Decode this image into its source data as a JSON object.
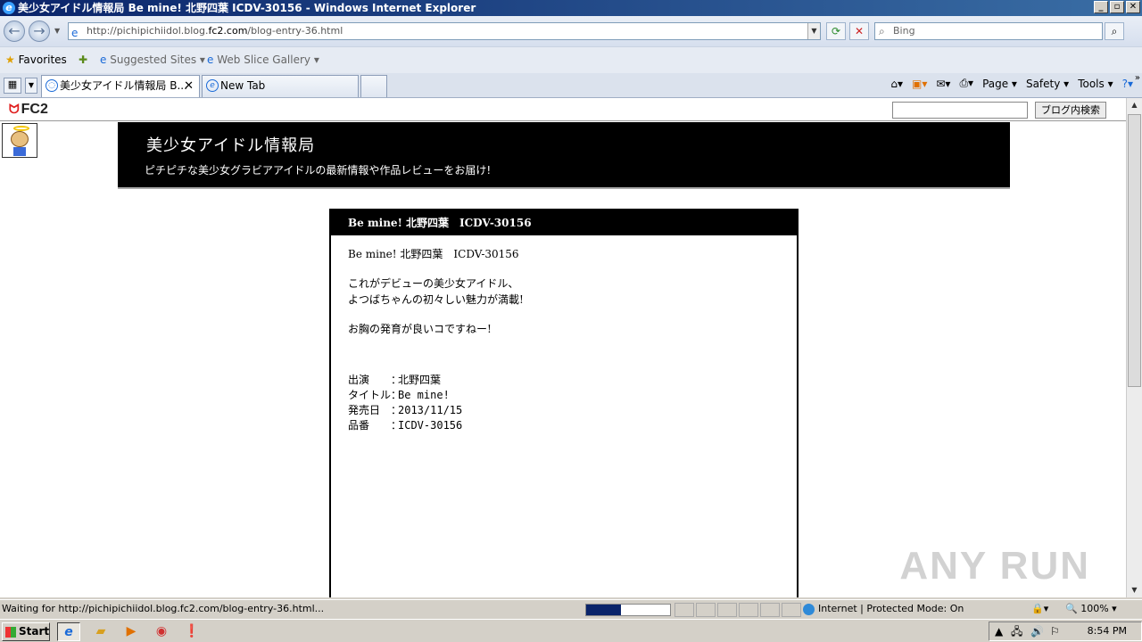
{
  "window": {
    "title": "美少女アイドル情報局 Be mine! 北野四葉 ICDV-30156 - Windows Internet Explorer",
    "buttons": [
      "_",
      "▫",
      "✕"
    ]
  },
  "address": {
    "url_prefix": "http://pichipichiidol.blog.",
    "url_domain": "fc2.com",
    "url_suffix": "/blog-entry-36.html",
    "search_placeholder": "Bing"
  },
  "favorites": {
    "favorites_label": "Favorites",
    "suggested_label": "Suggested Sites ▾",
    "webslice_label": "Web Slice Gallery ▾"
  },
  "tabs": [
    {
      "label": "美少女アイドル情報局 B..."
    },
    {
      "label": "New Tab"
    }
  ],
  "commandbar": {
    "page": "Page ▾",
    "safety": "Safety ▾",
    "tools": "Tools ▾"
  },
  "fc2": {
    "logo": "FC2",
    "search_button": "ブログ内検索"
  },
  "blog": {
    "title": "美少女アイドル情報局",
    "subtitle": "ピチピチな美少女グラビアアイドルの最新情報や作品レビューをお届け!"
  },
  "entry": {
    "heading": "Be mine! 北野四葉　ICDV-30156",
    "line1": "Be mine! 北野四葉　ICDV-30156",
    "para1a": "これがデビューの美少女アイドル、",
    "para1b": "よつばちゃんの初々しい魅力が満載!",
    "para2": "お胸の発育が良いコですねー!",
    "meta": [
      {
        "key": "出演　　：",
        "value": "北野四葉"
      },
      {
        "key": "タイトル：",
        "value": "Be mine!"
      },
      {
        "key": "発売日　：",
        "value": "2013/11/15"
      },
      {
        "key": "品番　　：",
        "value": "ICDV-30156"
      }
    ]
  },
  "watermark": "ANY RUN",
  "status": {
    "text": "Waiting for http://pichipichiidol.blog.fc2.com/blog-entry-36.html...",
    "progress": 0.42,
    "zone": "Internet | Protected Mode: On",
    "zoom": "100%"
  },
  "taskbar": {
    "start": "Start",
    "time": "8:54 PM"
  },
  "colors": {
    "titlebar": "#0a246a",
    "header_bg": "#000000",
    "progress": "#0a246a"
  }
}
